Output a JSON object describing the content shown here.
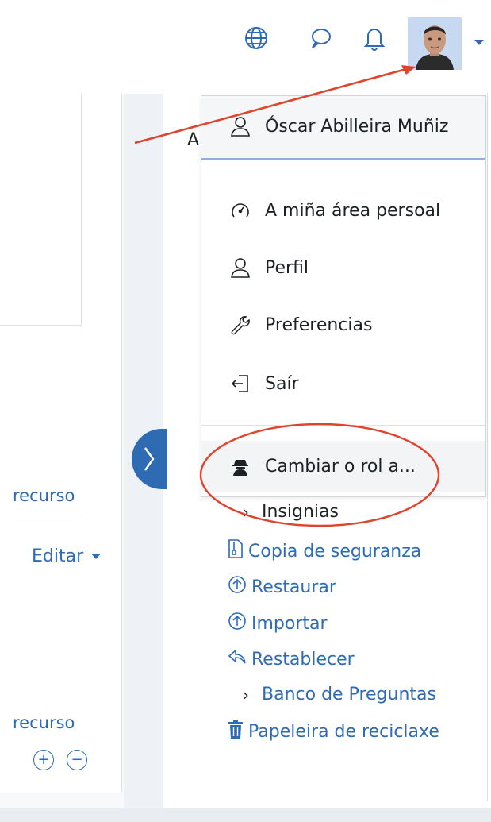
{
  "colors": {
    "accent": "#2f6bb3",
    "annotation": "#e0432c"
  },
  "topbar": {
    "icons": [
      "globe-icon",
      "chat-bubble-icon",
      "bell-icon",
      "user-avatar",
      "caret-down-icon"
    ]
  },
  "main": {
    "heading_letter": "A",
    "left_links": [
      "recurso",
      "recurso"
    ],
    "edit_label": "Editar",
    "edit_icon": "caret-down-icon",
    "section_controls": [
      "plus-circle-icon",
      "minus-circle-icon"
    ]
  },
  "user_menu": {
    "user_name": "Óscar Abilleira Muñiz",
    "items": [
      {
        "label": "A miña área persoal",
        "icon": "gauge-icon"
      },
      {
        "label": "Perfil",
        "icon": "user-icon"
      },
      {
        "label": "Preferencias",
        "icon": "wrench-icon"
      },
      {
        "label": "Saír",
        "icon": "sign-out-icon"
      },
      {
        "label": "Cambiar o rol a...",
        "icon": "user-secret-icon"
      }
    ]
  },
  "admin_links": [
    {
      "label": "Insignias",
      "icon": "chevron-right-icon"
    },
    {
      "label": "Copia de seguranza",
      "icon": "file-archive-icon"
    },
    {
      "label": "Restaurar",
      "icon": "upload-circle-icon"
    },
    {
      "label": "Importar",
      "icon": "upload-circle-icon"
    },
    {
      "label": "Restablecer",
      "icon": "reply-icon"
    },
    {
      "label": "Banco de Preguntas",
      "icon": "chevron-right-icon"
    },
    {
      "label": "Papeleira de reciclaxe",
      "icon": "trash-icon"
    }
  ]
}
